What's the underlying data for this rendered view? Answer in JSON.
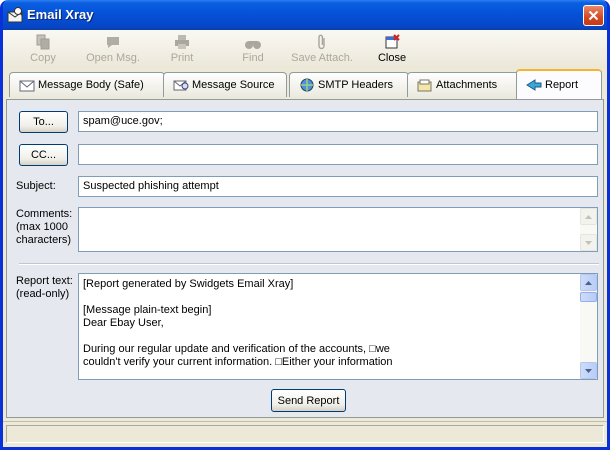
{
  "window": {
    "title": "Email Xray"
  },
  "toolbar": [
    {
      "label": "Copy",
      "icon": "copy-icon",
      "enabled": false
    },
    {
      "label": "Open Msg.",
      "icon": "open-message-icon",
      "enabled": false
    },
    {
      "label": "Print",
      "icon": "printer-icon",
      "enabled": false
    },
    {
      "label": "Find",
      "icon": "find-icon",
      "enabled": false
    },
    {
      "label": "Save Attach.",
      "icon": "paperclip-icon",
      "enabled": false
    },
    {
      "label": "Close",
      "icon": "close-window-icon",
      "enabled": true
    }
  ],
  "tabs": [
    {
      "label": "Message Body (Safe)",
      "icon": "message-body-icon",
      "active": false
    },
    {
      "label": "Message Source",
      "icon": "message-source-icon",
      "active": false
    },
    {
      "label": "SMTP Headers",
      "icon": "smtp-headers-icon",
      "active": false
    },
    {
      "label": "Attachments",
      "icon": "attachments-icon",
      "active": false
    },
    {
      "label": "Report",
      "icon": "report-icon",
      "active": true
    }
  ],
  "report": {
    "to_button": "To...",
    "to_value": "spam@uce.gov;",
    "cc_button": "CC...",
    "cc_value": "",
    "subject_label": "Subject:",
    "subject_value": "Suspected phishing attempt",
    "comments_label_lines": [
      "Comments:",
      "(max 1000",
      "characters)"
    ],
    "comments_value": "",
    "report_label_lines": [
      "Report text:",
      "(read-only)"
    ],
    "report_text_lines": [
      "[Report generated by Swidgets Email Xray]",
      "",
      "[Message plain-text begin]",
      "Dear Ebay User,",
      "",
      "During our regular update and verification of the accounts, □we",
      "couldn't verify your current information. □Either your information"
    ],
    "send_button": "Send Report"
  },
  "colors": {
    "title_bar": "#0550d8",
    "close_button": "#d54823",
    "active_tab_accent": "#f5b331",
    "panel": "#e6e8f0"
  }
}
